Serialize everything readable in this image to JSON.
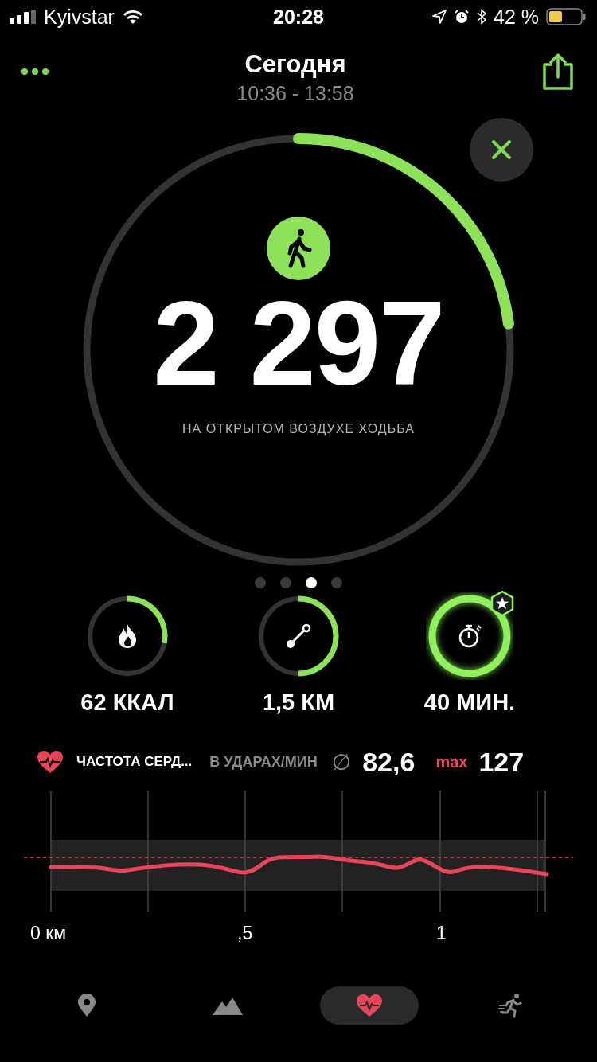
{
  "status_bar": {
    "carrier": "Kyivstar",
    "time": "20:28",
    "battery": "42 %"
  },
  "header": {
    "title": "Сегодня",
    "subtitle": "10:36 - 13:58"
  },
  "main_ring": {
    "value": "2 297",
    "label": "НА ОТКРЫТОМ ВОЗДУХЕ ХОДЬБА"
  },
  "page_dots": [
    {
      "selected": false
    },
    {
      "selected": false
    },
    {
      "selected": true
    },
    {
      "selected": false
    }
  ],
  "stats": [
    {
      "kind": "calories",
      "value": "62 ККАЛ",
      "achieved": false
    },
    {
      "kind": "distance",
      "value": "1,5 КМ",
      "achieved": false
    },
    {
      "kind": "duration",
      "value": "40 МИН.",
      "achieved": true
    }
  ],
  "heart_rate": {
    "title": "ЧАСТОТА СЕРД...",
    "unit": "В УДАРАХ/МИН",
    "avg_symbol": "∅",
    "avg": "82,6",
    "max_label": "max",
    "max": "127"
  },
  "chart_axis": {
    "labels": [
      "0 км",
      ",5",
      "1"
    ]
  },
  "tab_bar": [
    {
      "kind": "map",
      "selected": false
    },
    {
      "kind": "elevation",
      "selected": false
    },
    {
      "kind": "heart",
      "selected": true
    },
    {
      "kind": "splits",
      "selected": false
    }
  ]
}
